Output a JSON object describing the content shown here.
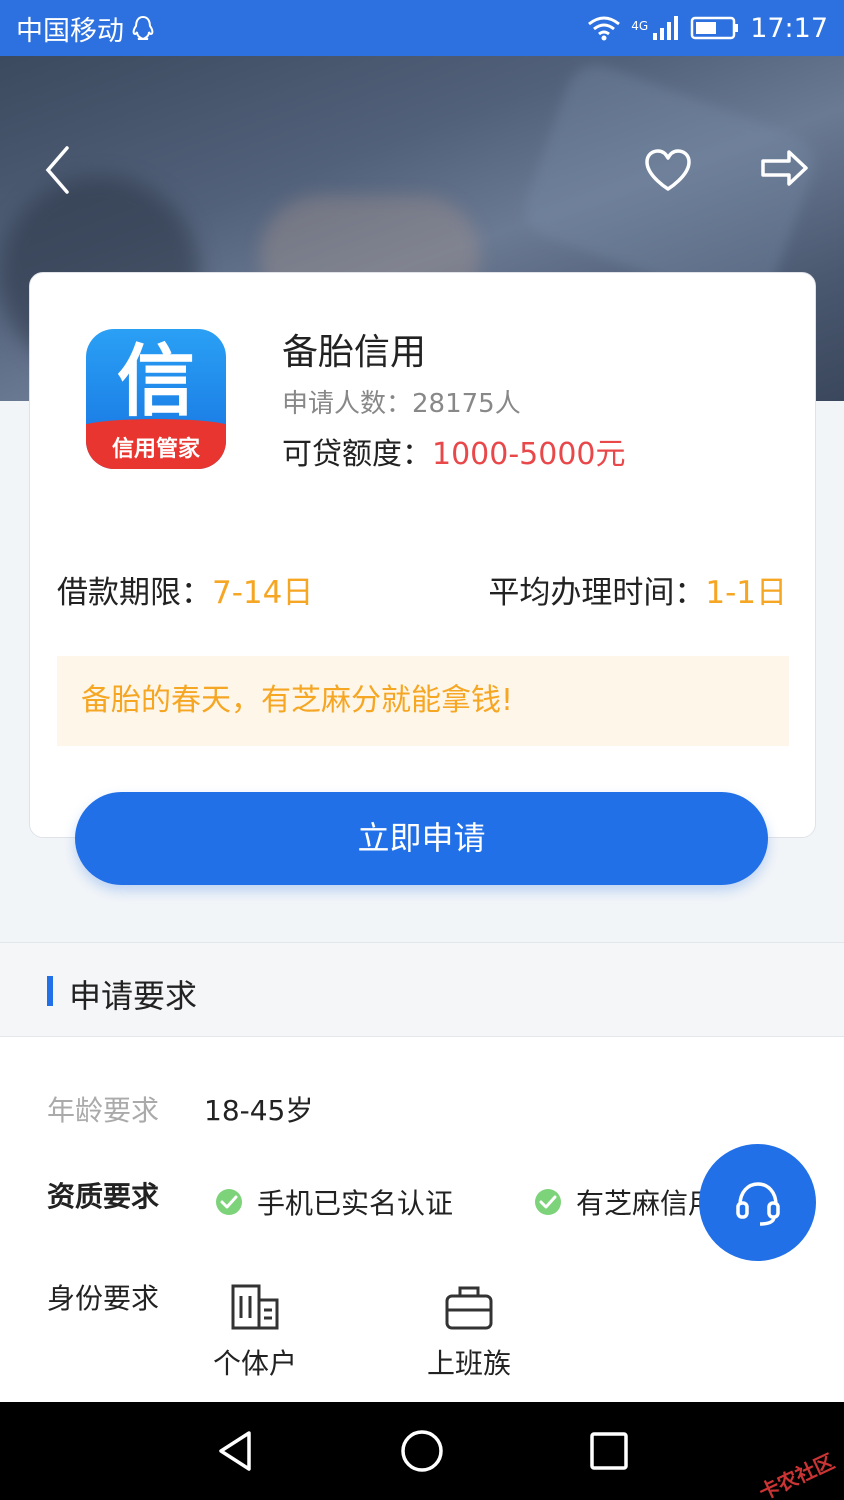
{
  "status_bar": {
    "carrier": "中国移动",
    "network": "4G",
    "time": "17:17"
  },
  "hero": {
    "back_icon": "chevron-left-icon",
    "favorite_icon": "heart-icon",
    "share_icon": "share-arrow-icon"
  },
  "product": {
    "logo_glyph": "信",
    "logo_caption": "信用管家",
    "name": "备胎信用",
    "applicants_label": "申请人数：",
    "applicants_value": "28175人",
    "amount_label": "可贷额度：",
    "amount_value": "1000-5000元",
    "term_label": "借款期限：",
    "term_value": "7-14日",
    "avg_time_label": "平均办理时间：",
    "avg_time_value": "1-1日",
    "slogan": "备胎的春天，有芝麻分就能拿钱!"
  },
  "apply_button": "立即申请",
  "requirements": {
    "section_title": "申请要求",
    "age_label": "年龄要求",
    "age_value": "18-45岁",
    "qualification_label": "资质要求",
    "qualifications": [
      "手机已实名认证",
      "有芝麻信用"
    ],
    "identity_label": "身份要求",
    "identities": [
      "个体户",
      "上班族"
    ]
  },
  "support_fab_icon": "headset-icon",
  "nav_bar": {
    "back": "triangle-back-icon",
    "home": "circle-home-icon",
    "recents": "square-recents-icon"
  },
  "watermark": "卡农社区",
  "colors": {
    "primary": "#2170e8",
    "status_bar": "#2d71e0",
    "amount_red": "#e9484a",
    "highlight_orange": "#f5a623",
    "check_green": "#7dd37a"
  }
}
